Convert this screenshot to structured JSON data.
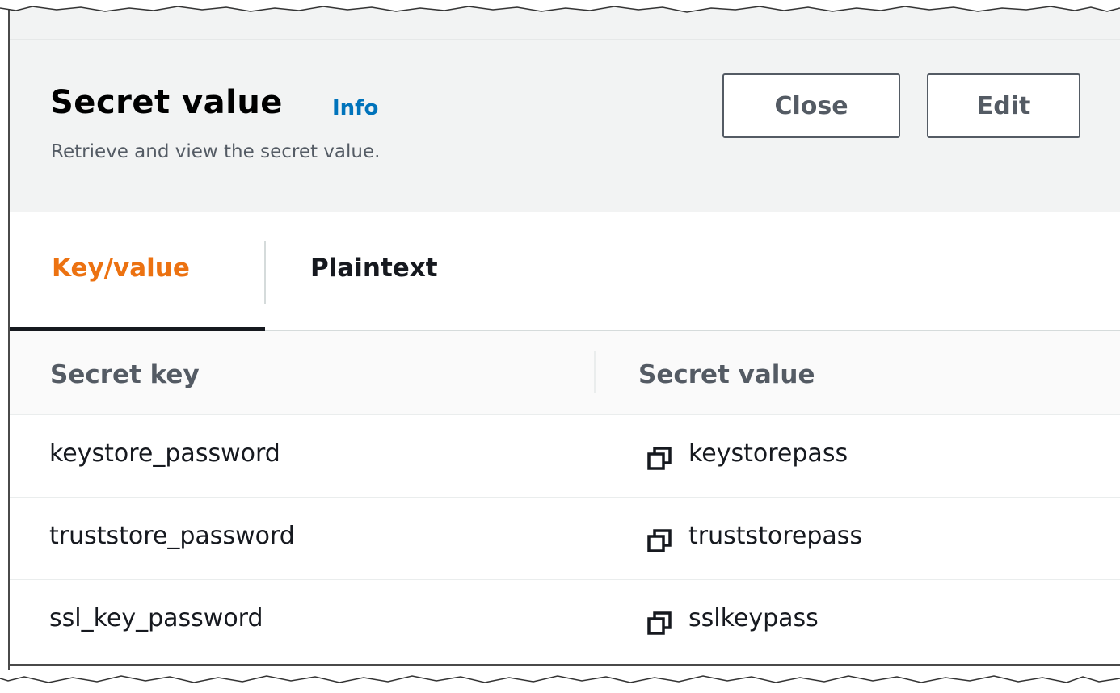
{
  "header": {
    "title": "Secret value",
    "info_link": "Info",
    "subtitle": "Retrieve and view the secret value.",
    "close_label": "Close",
    "edit_label": "Edit"
  },
  "tabs": [
    {
      "label": "Key/value",
      "active": true
    },
    {
      "label": "Plaintext",
      "active": false
    }
  ],
  "table": {
    "columns": [
      "Secret key",
      "Secret value"
    ],
    "rows": [
      {
        "key": "keystore_password",
        "value": "keystorepass"
      },
      {
        "key": "truststore_password",
        "value": "truststorepass"
      },
      {
        "key": "ssl_key_password",
        "value": "sslkeypass"
      }
    ]
  },
  "icons": {
    "copy": "copy-icon"
  },
  "colors": {
    "accent_tab": "#ec7211",
    "link": "#0073bb",
    "header_bg": "#f2f3f3"
  }
}
